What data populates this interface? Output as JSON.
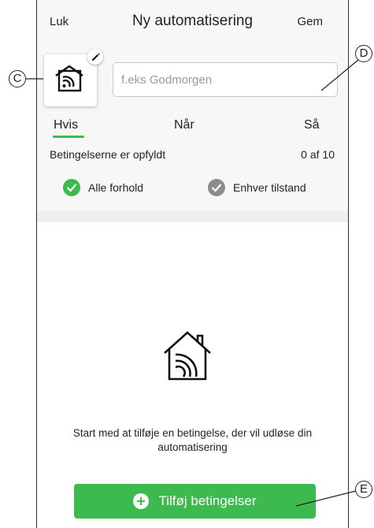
{
  "header": {
    "close_label": "Luk",
    "title": "Ny automatisering",
    "save_label": "Gem"
  },
  "automation_icon": {
    "icon": "house-signal-icon",
    "edit_icon": "pencil-icon"
  },
  "name_field": {
    "value": "",
    "placeholder": "f.eks Godmorgen"
  },
  "tabs": [
    {
      "label": "Hvis",
      "active": true
    },
    {
      "label": "Når",
      "active": false
    },
    {
      "label": "Så",
      "active": false
    }
  ],
  "conditions": {
    "label": "Betingelserne er opfyldt",
    "count": "0 af 10",
    "options": [
      {
        "label": "Alle forhold",
        "selected": true
      },
      {
        "label": "Enhver tilstand",
        "selected": false
      }
    ]
  },
  "empty_state": {
    "icon": "house-signal-icon",
    "text": "Start med at tilføje en betingelse, der vil udløse din automatisering"
  },
  "add_button": {
    "label": "Tilføj betingelser",
    "icon": "plus-circle-icon"
  },
  "callouts": {
    "c": "C",
    "d": "D",
    "e": "E"
  },
  "colors": {
    "accent": "#3dba4e",
    "inactive": "#8c8c8c",
    "panel_bg": "#f7f7f7"
  }
}
